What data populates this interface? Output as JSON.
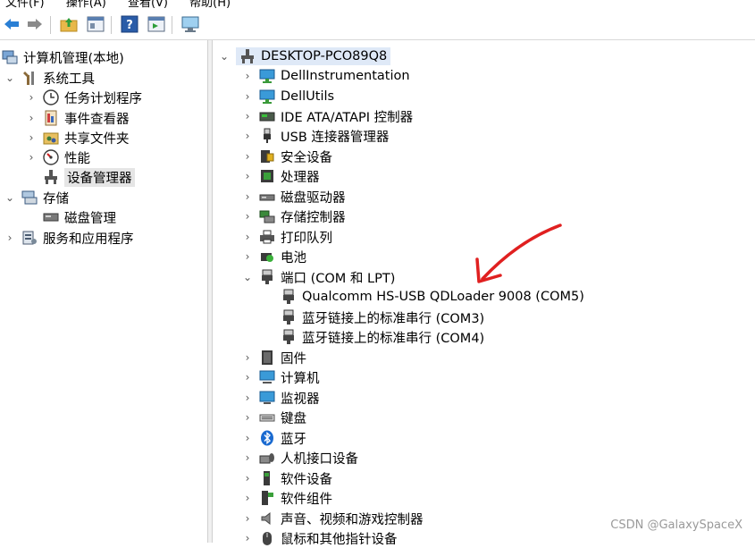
{
  "menu": [
    "文件(F)",
    "操作(A)",
    "查看(V)",
    "帮助(H)"
  ],
  "toolbar": {
    "icons": [
      "back-arrow-icon",
      "forward-arrow-icon",
      "folder-up-icon",
      "properties-icon",
      "help-icon",
      "console-icon",
      "monitor-icon"
    ]
  },
  "left_tree": [
    {
      "label": "计算机管理(本地)",
      "icon": "computer-management-icon"
    },
    {
      "label": "系统工具",
      "icon": "tools-icon"
    },
    {
      "label": "任务计划程序",
      "icon": "clock-icon"
    },
    {
      "label": "事件查看器",
      "icon": "event-viewer-icon"
    },
    {
      "label": "共享文件夹",
      "icon": "shared-folder-icon"
    },
    {
      "label": "性能",
      "icon": "performance-icon"
    },
    {
      "label": "设备管理器",
      "icon": "device-manager-icon"
    },
    {
      "label": "存储",
      "icon": "storage-icon"
    },
    {
      "label": "磁盘管理",
      "icon": "disk-management-icon"
    },
    {
      "label": "服务和应用程序",
      "icon": "services-icon"
    }
  ],
  "device_tree": {
    "root": "DESKTOP-PCO89Q8",
    "items": [
      {
        "label": "DellInstrumentation",
        "icon": "monitor-icon"
      },
      {
        "label": "DellUtils",
        "icon": "monitor-icon"
      },
      {
        "label": "IDE ATA/ATAPI 控制器",
        "icon": "ide-icon"
      },
      {
        "label": "USB 连接器管理器",
        "icon": "usb-icon"
      },
      {
        "label": "安全设备",
        "icon": "security-icon"
      },
      {
        "label": "处理器",
        "icon": "cpu-icon"
      },
      {
        "label": "磁盘驱动器",
        "icon": "disk-icon"
      },
      {
        "label": "存储控制器",
        "icon": "storage-controller-icon"
      },
      {
        "label": "打印队列",
        "icon": "printer-icon"
      },
      {
        "label": "电池",
        "icon": "battery-icon"
      },
      {
        "label": "端口 (COM 和 LPT)",
        "icon": "port-icon"
      },
      {
        "label": "Qualcomm HS-USB QDLoader 9008 (COM5)",
        "icon": "port-icon"
      },
      {
        "label": "蓝牙链接上的标准串行 (COM3)",
        "icon": "port-icon"
      },
      {
        "label": "蓝牙链接上的标准串行 (COM4)",
        "icon": "port-icon"
      },
      {
        "label": "固件",
        "icon": "firmware-icon"
      },
      {
        "label": "计算机",
        "icon": "computer-icon"
      },
      {
        "label": "监视器",
        "icon": "monitor-icon"
      },
      {
        "label": "键盘",
        "icon": "keyboard-icon"
      },
      {
        "label": "蓝牙",
        "icon": "bluetooth-icon"
      },
      {
        "label": "人机接口设备",
        "icon": "hid-icon"
      },
      {
        "label": "软件设备",
        "icon": "software-device-icon"
      },
      {
        "label": "软件组件",
        "icon": "software-component-icon"
      },
      {
        "label": "声音、视频和游戏控制器",
        "icon": "audio-icon"
      },
      {
        "label": "鼠标和其他指针设备",
        "icon": "mouse-icon"
      }
    ]
  },
  "annotation": {
    "color": "#e02020"
  },
  "watermark": "CSDN @GalaxySpaceX"
}
